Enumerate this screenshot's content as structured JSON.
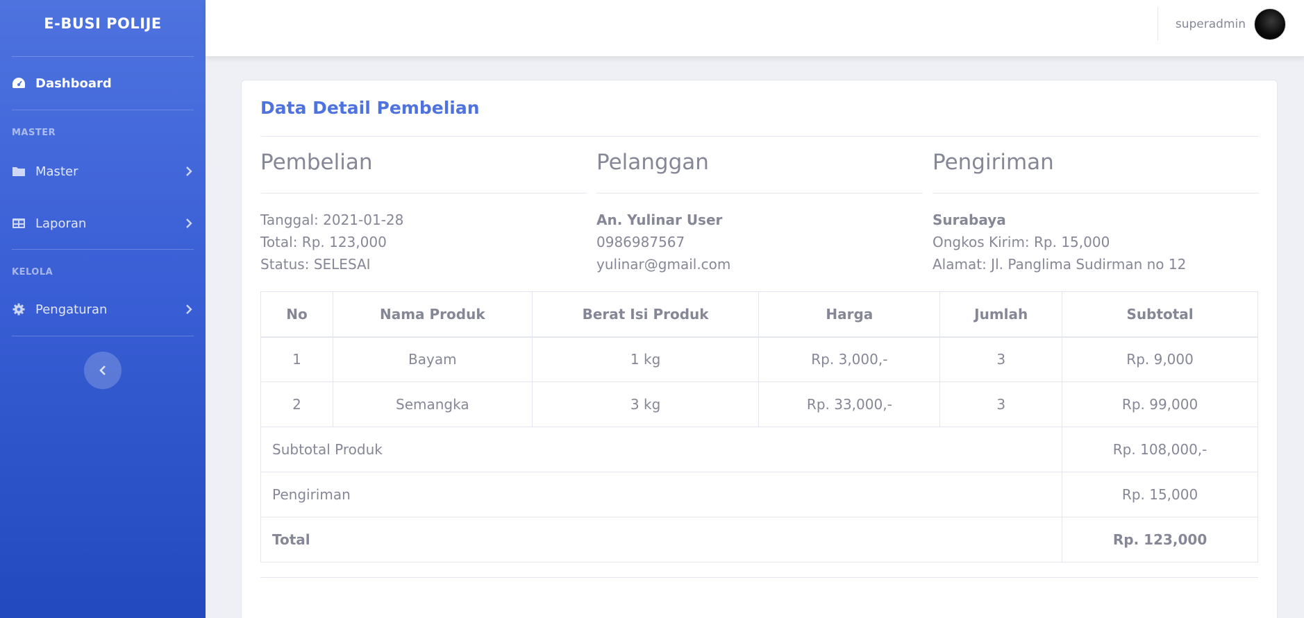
{
  "sidebar": {
    "brand": "E-BUSI POLIJE",
    "dashboard_label": "Dashboard",
    "heading_master": "MASTER",
    "master_label": "Master",
    "laporan_label": "Laporan",
    "heading_kelola": "KELOLA",
    "pengaturan_label": "Pengaturan"
  },
  "topbar": {
    "username": "superadmin"
  },
  "card": {
    "title": "Data Detail Pembelian",
    "pembelian": {
      "heading": "Pembelian",
      "tanggal": "Tanggal: 2021-01-28",
      "total": "Total: Rp. 123,000",
      "status": "Status: SELESAI"
    },
    "pelanggan": {
      "heading": "Pelanggan",
      "name": "An. Yulinar User",
      "phone": "0986987567",
      "email": "yulinar@gmail.com"
    },
    "pengiriman": {
      "heading": "Pengiriman",
      "city": "Surabaya",
      "ongkos": "Ongkos Kirim: Rp. 15,000",
      "alamat": "Alamat: Jl. Panglima Sudirman no 12"
    },
    "table": {
      "headers": [
        "No",
        "Nama Produk",
        "Berat Isi Produk",
        "Harga",
        "Jumlah",
        "Subtotal"
      ],
      "rows": [
        [
          "1",
          "Bayam",
          "1 kg",
          "Rp. 3,000,-",
          "3",
          "Rp. 9,000"
        ],
        [
          "2",
          "Semangka",
          "3 kg",
          "Rp. 33,000,-",
          "3",
          "Rp. 99,000"
        ]
      ],
      "subtotal_label": "Subtotal Produk",
      "subtotal_value": "Rp. 108,000,-",
      "pengiriman_label": "Pengiriman",
      "pengiriman_value": "Rp. 15,000",
      "total_label": "Total",
      "total_value": "Rp. 123,000"
    }
  }
}
